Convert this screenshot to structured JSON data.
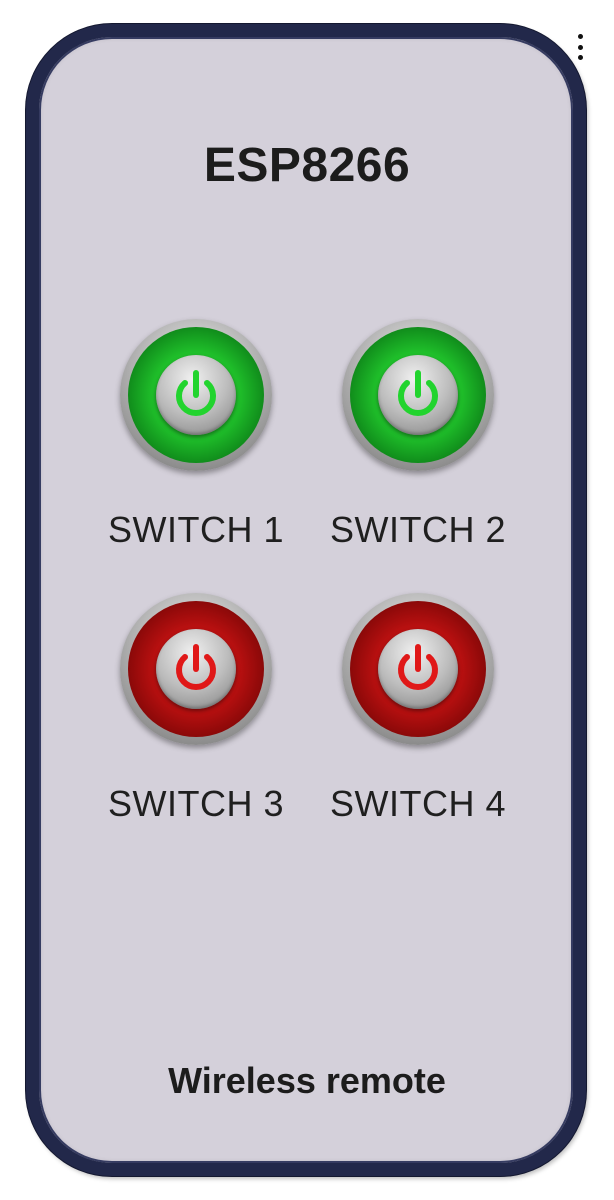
{
  "app": {
    "title": "ESP8266",
    "footer": "Wireless remote"
  },
  "switches": [
    {
      "label": "SWITCH 1",
      "state": "on",
      "color": "#22d42e"
    },
    {
      "label": "SWITCH 2",
      "state": "on",
      "color": "#22d42e"
    },
    {
      "label": "SWITCH 3",
      "state": "off",
      "color": "#e01818"
    },
    {
      "label": "SWITCH 4",
      "state": "off",
      "color": "#e01818"
    }
  ],
  "icons": {
    "menu": "more-vertical-icon",
    "power": "power-icon"
  },
  "colors": {
    "remote_body": "#d4d0da",
    "remote_border": "#22284a",
    "on": "#22d42e",
    "off": "#e01818"
  }
}
